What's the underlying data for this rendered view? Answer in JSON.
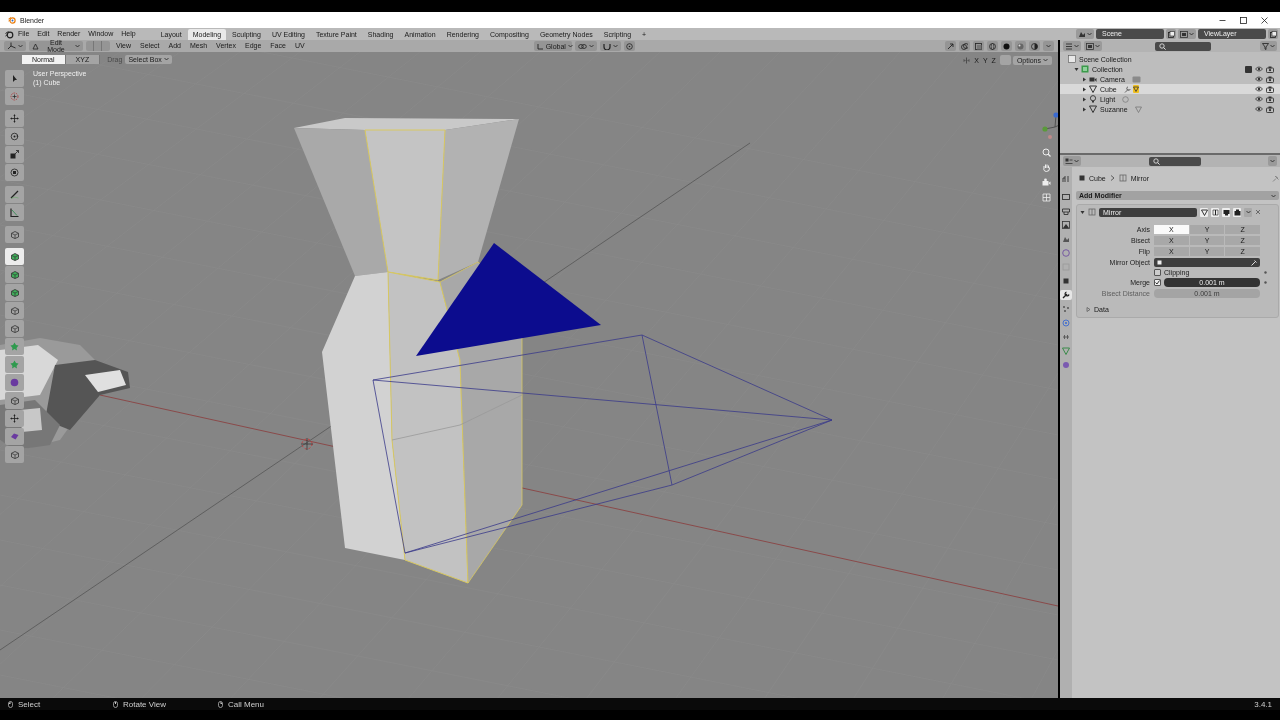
{
  "window": {
    "title": "Blender"
  },
  "menus": [
    "File",
    "Edit",
    "Render",
    "Window",
    "Help"
  ],
  "workspaces": [
    {
      "label": "Layout",
      "selected": false
    },
    {
      "label": "Modeling",
      "selected": true
    },
    {
      "label": "Sculpting",
      "selected": false
    },
    {
      "label": "UV Editing",
      "selected": false
    },
    {
      "label": "Texture Paint",
      "selected": false
    },
    {
      "label": "Shading",
      "selected": false
    },
    {
      "label": "Animation",
      "selected": false
    },
    {
      "label": "Rendering",
      "selected": false
    },
    {
      "label": "Compositing",
      "selected": false
    },
    {
      "label": "Geometry Nodes",
      "selected": false
    },
    {
      "label": "Scripting",
      "selected": false
    }
  ],
  "add_workspace": "+",
  "scene": {
    "scene": "Scene",
    "view_layer": "ViewLayer"
  },
  "viewport_header": {
    "mode": "Edit Mode",
    "menus": [
      "View",
      "Select",
      "Add",
      "Mesh",
      "Vertex",
      "Edge",
      "Face",
      "UV"
    ],
    "orientation": "Global"
  },
  "tool_settings": {
    "orientations": [
      {
        "label": "Normal",
        "selected": true
      },
      {
        "label": "XYZ",
        "selected": false
      }
    ],
    "drag_label": "Drag",
    "drag_mode": "Select Box"
  },
  "viewport": {
    "view_name": "User Perspective",
    "object_name": "(1) Cube",
    "mirror_axes": [
      "X",
      "Y",
      "Z"
    ],
    "options": "Options",
    "tools": [
      {
        "selected": false
      },
      {
        "selected": false
      },
      {
        "selected": false
      },
      {
        "selected": false
      },
      {
        "selected": false
      },
      {
        "selected": false
      },
      {
        "selected": false
      },
      {
        "selected": false
      },
      {
        "selected": false
      },
      {
        "selected": true
      },
      {
        "selected": false
      },
      {
        "selected": false
      },
      {
        "selected": false
      },
      {
        "selected": false
      },
      {
        "selected": false
      },
      {
        "selected": false
      },
      {
        "selected": false
      },
      {
        "selected": false
      },
      {
        "selected": false
      },
      {
        "selected": false
      },
      {
        "selected": false
      }
    ]
  },
  "outliner": {
    "root": "Scene Collection",
    "items": [
      {
        "name": "Collection",
        "expanded": true,
        "checked": true,
        "children": [
          {
            "name": "Camera",
            "expanded": false,
            "selected": false
          },
          {
            "name": "Cube",
            "expanded": false,
            "selected": true
          },
          {
            "name": "Light",
            "expanded": false,
            "selected": false
          },
          {
            "name": "Suzanne",
            "expanded": false,
            "selected": false
          }
        ]
      }
    ]
  },
  "properties": {
    "tabs": [
      {
        "selected": false
      },
      {
        "selected": false
      },
      {
        "selected": false
      },
      {
        "selected": false
      },
      {
        "selected": false
      },
      {
        "selected": false
      },
      {
        "selected": false
      },
      {
        "selected": false
      },
      {
        "selected": true
      },
      {
        "selected": false
      },
      {
        "selected": false
      },
      {
        "selected": false
      },
      {
        "selected": false
      },
      {
        "selected": false
      }
    ],
    "breadcrumb": [
      "Cube",
      "Mirror"
    ],
    "add_modifier": "Add Modifier",
    "modifier": {
      "name": "Mirror",
      "expanded": true,
      "rows": [
        {
          "label": "Axis",
          "options": [
            {
              "label": "X",
              "selected": true
            },
            {
              "label": "Y",
              "selected": false
            },
            {
              "label": "Z",
              "selected": false
            }
          ]
        },
        {
          "label": "Bisect",
          "options": [
            {
              "label": "X",
              "selected": false
            },
            {
              "label": "Y",
              "selected": false
            },
            {
              "label": "Z",
              "selected": false
            }
          ]
        },
        {
          "label": "Flip",
          "options": [
            {
              "label": "X",
              "selected": false
            },
            {
              "label": "Y",
              "selected": false
            },
            {
              "label": "Z",
              "selected": false
            }
          ]
        }
      ],
      "mirror_object_label": "Mirror Object",
      "clipping": {
        "label": "Clipping",
        "checked": false
      },
      "merge": {
        "label": "Merge",
        "checked": true,
        "value": "0.001 m"
      },
      "bisect_distance": {
        "label": "Bisect Distance",
        "value": "0.001 m",
        "disabled": true
      },
      "data": {
        "label": "Data",
        "expanded": false
      }
    }
  },
  "status_bar": {
    "hints": [
      "Select",
      "Rotate View",
      "Call Menu"
    ],
    "version": "3.4.1"
  }
}
